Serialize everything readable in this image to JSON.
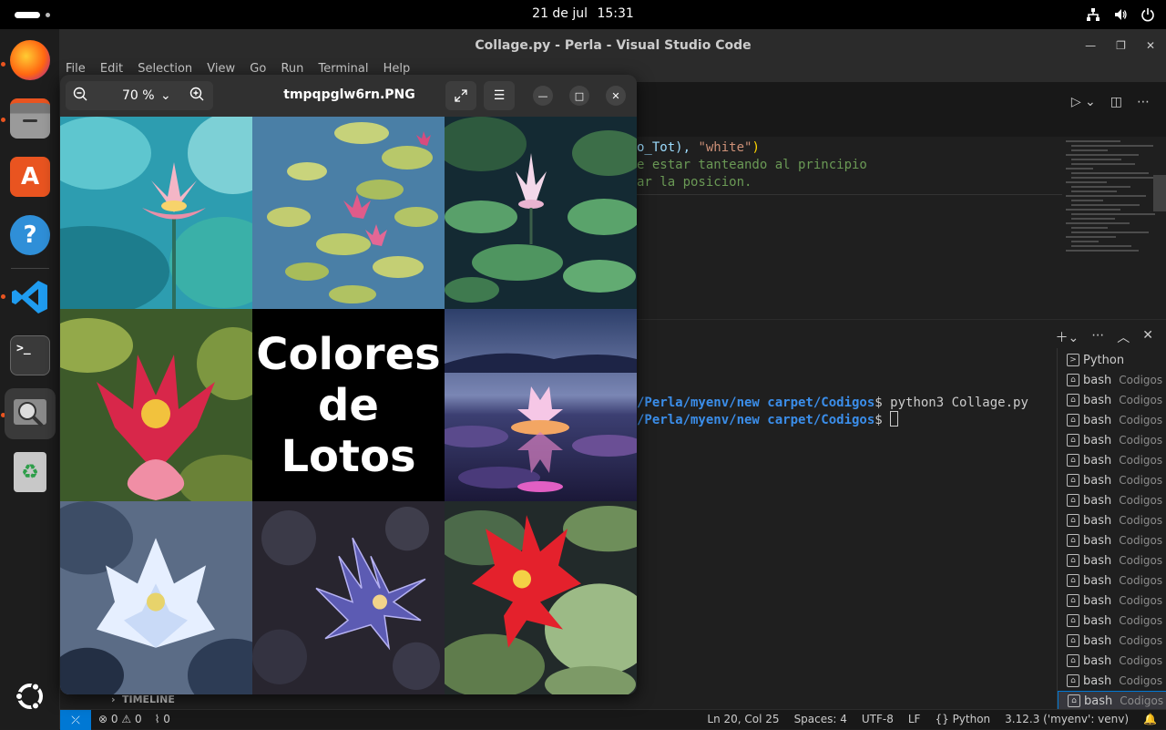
{
  "topbar": {
    "date": "21 de jul",
    "time": "15:31",
    "tray_icons": [
      "network-icon",
      "volume-icon",
      "power-icon"
    ]
  },
  "dock": {
    "items": [
      "firefox",
      "files",
      "app-center",
      "help",
      "vscode",
      "terminal",
      "image-viewer",
      "trash",
      "show-apps"
    ]
  },
  "vscode": {
    "window_title": "Collage.py - Perla - Visual Studio Code",
    "menu": [
      "File",
      "Edit",
      "Selection",
      "View",
      "Go",
      "Run",
      "Terminal",
      "Help"
    ],
    "code_lines": [
      {
        "prefix": "o_Tot), ",
        "str": "\"white\"",
        "suffix": ")"
      },
      {
        "comment": "e estar tanteando al principio"
      },
      {
        "comment": "ar la posicion."
      }
    ],
    "terminal": {
      "path": "/Perla/myenv/new carpet/Codigos",
      "line1_cmd": "$ python3 Collage.py",
      "line2_cmd": "$ "
    },
    "terminal_list": {
      "first": "Python",
      "item_name": "bash",
      "item_sub": "Codigos",
      "count": 17
    },
    "timeline_label": "TIMELINE",
    "status": {
      "errors": "0",
      "warnings": "0",
      "ports": "0",
      "position": "Ln 20, Col 25",
      "spaces": "Spaces: 4",
      "encoding": "UTF-8",
      "eol": "LF",
      "language": "Python",
      "interpreter": "3.12.3 ('myenv': venv)"
    }
  },
  "viewer": {
    "title": "tmpqpglw6rn.PNG",
    "zoom": "70 %",
    "center_text": [
      "Colores",
      "de",
      "Lotos"
    ]
  }
}
